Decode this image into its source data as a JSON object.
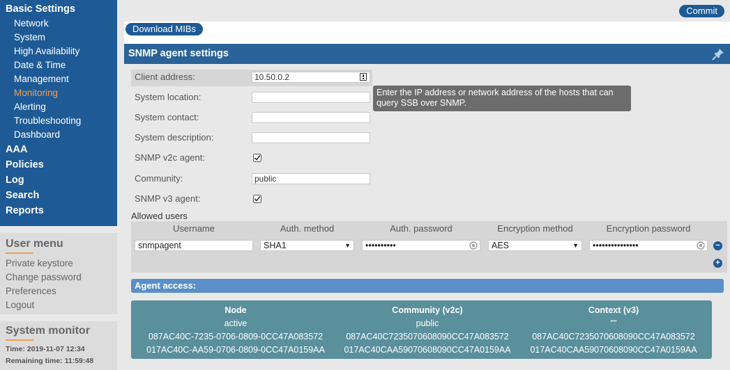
{
  "sidebar": {
    "basic_settings": "Basic Settings",
    "subitems": [
      "Network",
      "System",
      "High Availability",
      "Date & Time",
      "Management",
      "Monitoring",
      "Alerting",
      "Troubleshooting",
      "Dashboard"
    ],
    "active_subitem": "Monitoring",
    "top_items": [
      "AAA",
      "Policies",
      "Log",
      "Search",
      "Reports"
    ]
  },
  "user_menu": {
    "title": "User menu",
    "links": [
      "Private keystore",
      "Change password",
      "Preferences",
      "Logout"
    ]
  },
  "system_monitor": {
    "title": "System monitor",
    "time": "Time: 2019-11-07 12:34",
    "remaining": "Remaining time: 11:59:48"
  },
  "toolbar": {
    "commit": "Commit",
    "download_mibs": "Download MIBs"
  },
  "snmp": {
    "title": "SNMP agent settings",
    "fields": {
      "client_address": {
        "label": "Client address:",
        "value": "10.50.0.2"
      },
      "system_location": {
        "label": "System location:",
        "value": ""
      },
      "system_contact": {
        "label": "System contact:",
        "value": ""
      },
      "system_description": {
        "label": "System description:",
        "value": ""
      },
      "v2c_agent": {
        "label": "SNMP v2c agent:",
        "checked": true
      },
      "community": {
        "label": "Community:",
        "value": "public"
      },
      "v3_agent": {
        "label": "SNMP v3 agent:",
        "checked": true
      }
    },
    "tooltip": "Enter the IP address or network address of the hosts that can query SSB over SNMP.",
    "allowed_users_label": "Allowed users",
    "users_headers": [
      "Username",
      "Auth. method",
      "Auth. password",
      "Encryption method",
      "Encryption password"
    ],
    "user_row": {
      "username": "snmpagent",
      "auth_method": "SHA1",
      "auth_password": "••••••••••",
      "encryption_method": "AES",
      "encryption_password": "•••••••••••••••"
    },
    "agent_access_label": "Agent access:",
    "agent_table": {
      "headers": [
        "Node",
        "Community (v2c)",
        "Context (v3)"
      ],
      "rows": [
        [
          "active",
          "public",
          "\"\""
        ],
        [
          "087AC40C-7235-0706-0809-0CC47A083572",
          "087AC40C7235070608090CC47A083572",
          "087AC40C7235070608090CC47A083572"
        ],
        [
          "017AC40C-AA59-0706-0809-0CC47A0159AA",
          "017AC40CAA59070608090CC47A0159AA",
          "017AC40CAA59070608090CC47A0159AA"
        ]
      ]
    }
  },
  "colors": {
    "nav_bg": "#1e5a96",
    "active": "#f0a050",
    "header": "#2a6399",
    "agent_table": "#5a8f9c"
  }
}
